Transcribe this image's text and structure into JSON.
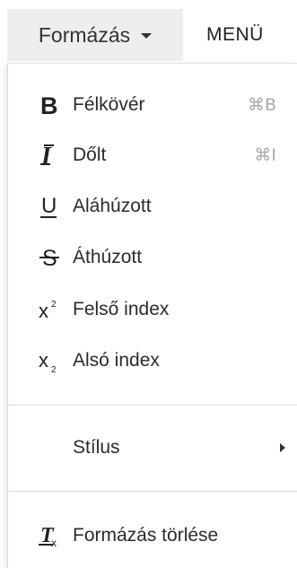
{
  "toolbar": {
    "format_label": "Formázás",
    "menu_label": "MENÜ"
  },
  "dropdown": {
    "items": [
      {
        "label": "Félkövér",
        "shortcut": "⌘B",
        "icon": "bold-icon"
      },
      {
        "label": "Dőlt",
        "shortcut": "⌘I",
        "icon": "italic-icon"
      },
      {
        "label": "Aláhúzott",
        "icon": "underline-icon"
      },
      {
        "label": "Áthúzott",
        "icon": "strikethrough-icon"
      },
      {
        "label": "Felső index",
        "icon": "superscript-icon"
      },
      {
        "label": "Alsó index",
        "icon": "subscript-icon"
      }
    ],
    "style_label": "Stílus",
    "clear_label": "Formázás törlése"
  }
}
